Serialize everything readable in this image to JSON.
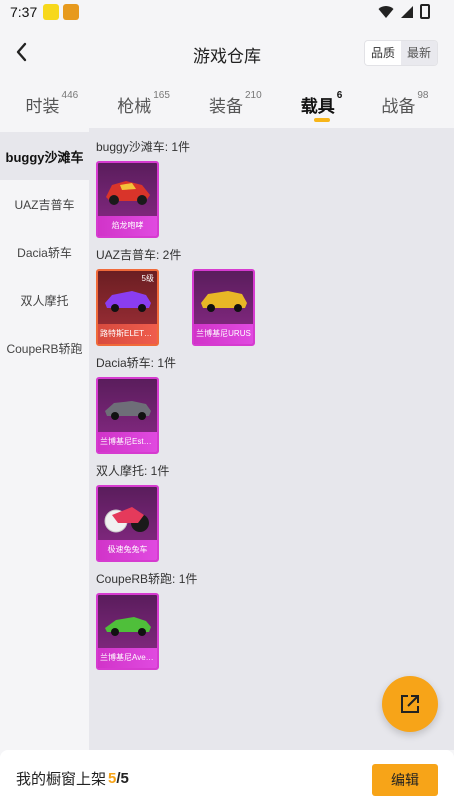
{
  "status_bar": {
    "time": "7:37"
  },
  "header": {
    "title": "游戏仓库",
    "sort_options": [
      "品质",
      "最新"
    ],
    "sort_active": "最新"
  },
  "tabs": [
    {
      "label": "时装",
      "count": "446"
    },
    {
      "label": "枪械",
      "count": "165"
    },
    {
      "label": "装备",
      "count": "210"
    },
    {
      "label": "载具",
      "count": "6"
    },
    {
      "label": "战备",
      "count": "98"
    }
  ],
  "sidebar": {
    "items": [
      {
        "label": "buggy沙滩车"
      },
      {
        "label": "UAZ吉普车"
      },
      {
        "label": "Dacia轿车"
      },
      {
        "label": "双人摩托"
      },
      {
        "label": "CoupeRB轿跑"
      }
    ]
  },
  "groups": [
    {
      "title": "buggy沙滩车: 1件",
      "items": [
        {
          "name": "焰龙咆哮",
          "level": ""
        }
      ]
    },
    {
      "title": "UAZ吉普车: 2件",
      "items": [
        {
          "name": "路特斯ELETRE",
          "level": "5级"
        },
        {
          "name": "兰博基尼URUS",
          "level": ""
        }
      ]
    },
    {
      "title": "Dacia轿车: 1件",
      "items": [
        {
          "name": "兰博基尼Estoque",
          "level": ""
        }
      ]
    },
    {
      "title": "双人摩托: 1件",
      "items": [
        {
          "name": "极速兔兔车",
          "level": ""
        }
      ]
    },
    {
      "title": "CoupeRB轿跑: 1件",
      "items": [
        {
          "name": "兰博基尼Aventador",
          "level": ""
        }
      ]
    }
  ],
  "footer": {
    "label": "我的橱窗上架",
    "current": "5",
    "total": "5",
    "edit_label": "编辑"
  },
  "colors": {
    "accent": "#f7a418",
    "card_purple": "#d63bd0",
    "card_red": "#f06a3a"
  }
}
